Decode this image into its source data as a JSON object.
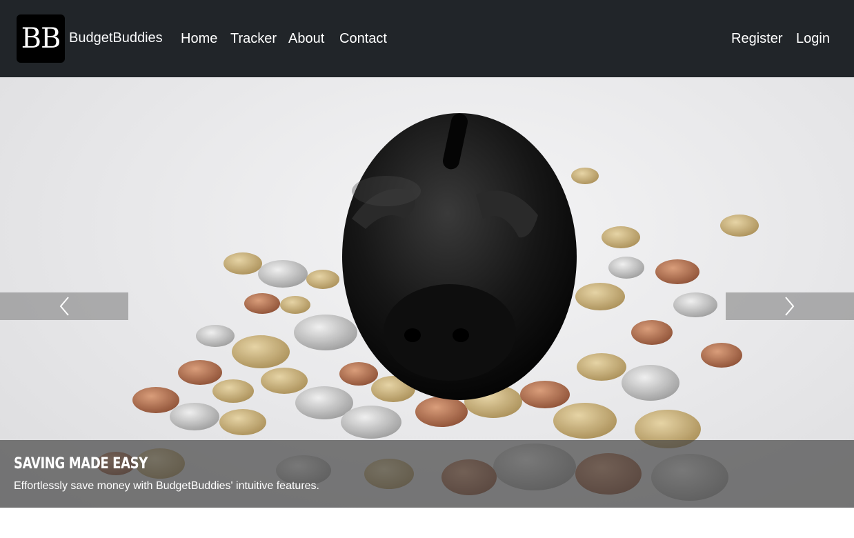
{
  "brand": {
    "logo_text": "BB",
    "name": "BudgetBuddies"
  },
  "nav": {
    "left": [
      {
        "label": "Home"
      },
      {
        "label": "Tracker"
      },
      {
        "label": "About"
      },
      {
        "label": "Contact"
      }
    ],
    "right": [
      {
        "label": "Register"
      },
      {
        "label": "Login"
      }
    ]
  },
  "carousel": {
    "slide_image": "piggy-bank-with-coins",
    "caption_title": "Saving Made Easy",
    "caption_text": "Effortlessly save money with BudgetBuddies' intuitive features.",
    "prev_icon": "chevron-left-icon",
    "next_icon": "chevron-right-icon"
  },
  "colors": {
    "navbar_bg": "#212529",
    "nav_text": "#ffffff",
    "caption_bg": "rgba(70,70,70,0.70)"
  }
}
